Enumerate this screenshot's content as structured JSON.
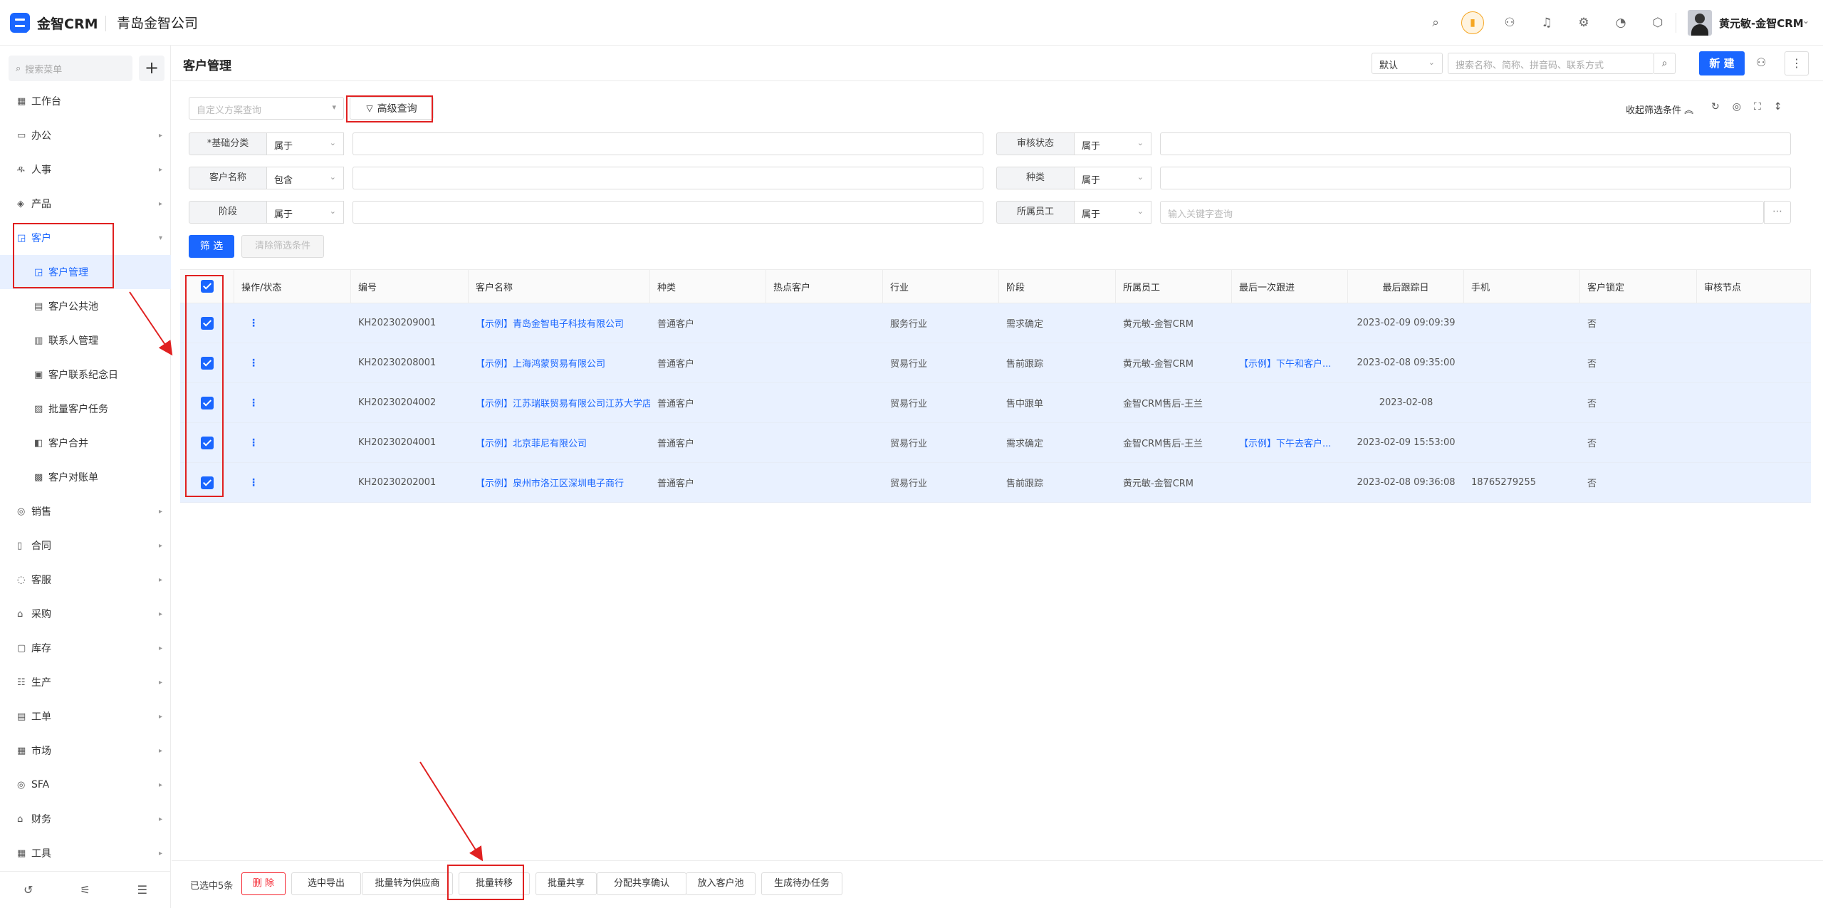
{
  "app": {
    "brand": "金智CRM",
    "company": "青岛金智公司",
    "user_name": "黄元敏-金智CRM"
  },
  "sidebar": {
    "search_placeholder": "搜索菜单",
    "items": [
      {
        "label": "工作台",
        "icon": "▦",
        "has_arrow": false
      },
      {
        "label": "办公",
        "icon": "▭",
        "has_arrow": true
      },
      {
        "label": "人事",
        "icon": "ዱ",
        "has_arrow": true
      },
      {
        "label": "产品",
        "icon": "◈",
        "has_arrow": true
      },
      {
        "label": "客户",
        "icon": "◲",
        "has_arrow": true,
        "expanded": true
      },
      {
        "label": "客户管理",
        "icon": "◲",
        "sub": true,
        "selected": true
      },
      {
        "label": "客户公共池",
        "icon": "▤",
        "sub": true
      },
      {
        "label": "联系人管理",
        "icon": "▥",
        "sub": true
      },
      {
        "label": "客户联系纪念日",
        "icon": "▣",
        "sub": true
      },
      {
        "label": "批量客户任务",
        "icon": "▨",
        "sub": true
      },
      {
        "label": "客户合并",
        "icon": "◧",
        "sub": true
      },
      {
        "label": "客户对账单",
        "icon": "▩",
        "sub": true
      },
      {
        "label": "销售",
        "icon": "◎",
        "has_arrow": true
      },
      {
        "label": "合同",
        "icon": "▯",
        "has_arrow": true
      },
      {
        "label": "客服",
        "icon": "◌",
        "has_arrow": true
      },
      {
        "label": "采购",
        "icon": "⌂",
        "has_arrow": true
      },
      {
        "label": "库存",
        "icon": "▢",
        "has_arrow": true
      },
      {
        "label": "生产",
        "icon": "☷",
        "has_arrow": true
      },
      {
        "label": "工单",
        "icon": "▤",
        "has_arrow": true
      },
      {
        "label": "市场",
        "icon": "▦",
        "has_arrow": true
      },
      {
        "label": "SFA",
        "icon": "◎",
        "has_arrow": true
      },
      {
        "label": "财务",
        "icon": "⌂",
        "has_arrow": true
      },
      {
        "label": "工具",
        "icon": "▦",
        "has_arrow": true
      }
    ]
  },
  "header": {
    "title": "客户管理",
    "view_select": "默认",
    "search_placeholder": "搜索名称、简称、拼音码、联系方式",
    "new_label": "新 建"
  },
  "filters": {
    "scheme_placeholder": "自定义方案查询",
    "advanced_label": "高级查询",
    "collapse_label": "收起筛选条件",
    "rows": [
      {
        "left": {
          "label": "*基础分类",
          "op": "属于",
          "value": ""
        },
        "right": {
          "label": "审核状态",
          "op": "属于",
          "value": ""
        }
      },
      {
        "left": {
          "label": "客户名称",
          "op": "包含",
          "value": ""
        },
        "right": {
          "label": "种类",
          "op": "属于",
          "value": ""
        }
      },
      {
        "left": {
          "label": "阶段",
          "op": "属于",
          "value": ""
        },
        "right": {
          "label": "所属员工",
          "op": "属于",
          "value": "输入关键字查询"
        }
      }
    ],
    "filter_btn": "筛 选",
    "clear_btn": "清除筛选条件"
  },
  "table": {
    "columns": [
      "操作/状态",
      "编号",
      "客户名称",
      "种类",
      "热点客户",
      "行业",
      "阶段",
      "所属员工",
      "最后一次跟进",
      "最后跟踪日",
      "手机",
      "客户锁定",
      "审核节点"
    ],
    "rows": [
      {
        "code": "KH20230209001",
        "name": "【示例】青岛金智电子科技有限公司",
        "kind": "普通客户",
        "hot": "",
        "industry": "服务行业",
        "stage": "需求确定",
        "owner": "黄元敏-金智CRM",
        "last_follow": "",
        "last_date": "2023-02-09 09:09:39",
        "phone": "",
        "locked": "否",
        "node": ""
      },
      {
        "code": "KH20230208001",
        "name": "【示例】上海鸿蒙贸易有限公司",
        "kind": "普通客户",
        "hot": "",
        "industry": "贸易行业",
        "stage": "售前跟踪",
        "owner": "黄元敏-金智CRM",
        "last_follow": "【示例】下午和客户...",
        "last_date": "2023-02-08 09:35:00",
        "phone": "",
        "locked": "否",
        "node": ""
      },
      {
        "code": "KH20230204002",
        "name": "【示例】江苏瑞联贸易有限公司江苏大学店",
        "kind": "普通客户",
        "hot": "",
        "industry": "贸易行业",
        "stage": "售中跟单",
        "owner": "金智CRM售后-王兰",
        "last_follow": "",
        "last_date": "2023-02-08",
        "phone": "",
        "locked": "否",
        "node": ""
      },
      {
        "code": "KH20230204001",
        "name": "【示例】北京菲尼有限公司",
        "kind": "普通客户",
        "hot": "",
        "industry": "贸易行业",
        "stage": "需求确定",
        "owner": "金智CRM售后-王兰",
        "last_follow": "【示例】下午去客户...",
        "last_date": "2023-02-09 15:53:00",
        "phone": "",
        "locked": "否",
        "node": ""
      },
      {
        "code": "KH20230202001",
        "name": "【示例】泉州市洛江区深圳电子商行",
        "kind": "普通客户",
        "hot": "",
        "industry": "贸易行业",
        "stage": "售前跟踪",
        "owner": "黄元敏-金智CRM",
        "last_follow": "",
        "last_date": "2023-02-08 09:36:08",
        "phone": "18765279255",
        "locked": "否",
        "node": ""
      }
    ]
  },
  "bottom": {
    "selected_text": "已选中5条",
    "buttons": [
      "删 除",
      "选中导出",
      "批量转为供应商",
      "批量转移",
      "批量共享",
      "分配共享确认",
      "放入客户池",
      "生成待办任务"
    ]
  }
}
